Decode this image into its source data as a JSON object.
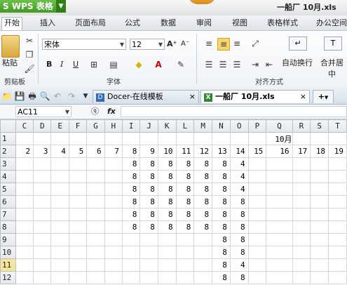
{
  "app": {
    "badge": "WPS 表格",
    "badge_prefix": "S",
    "doc_title": "一船厂 10月.xls"
  },
  "tabs": [
    "开始",
    "插入",
    "页面布局",
    "公式",
    "数据",
    "审阅",
    "视图",
    "表格样式",
    "办公空间"
  ],
  "ribbon": {
    "paste_label": "粘贴",
    "clipboard_label": "剪贴板",
    "font_name": "宋体",
    "font_size": "12",
    "bold": "B",
    "italic": "I",
    "underline": "U",
    "grow_font": "A⁺",
    "shrink_font": "A⁻",
    "font_group_label": "字体",
    "wrap_label": "自动换行",
    "merge_label": "合并居中",
    "align_group_label": "对齐方式"
  },
  "doc_tabs": [
    {
      "label": "Docer-在线模板",
      "closable": "×"
    },
    {
      "label": "一船厂 10月.xls",
      "closable": "×"
    }
  ],
  "add_tab": "+",
  "formula_bar": {
    "name_box": "AC11",
    "fx": "fx",
    "zoom": "ⓠ",
    "formula": ""
  },
  "sheet": {
    "columns": [
      "C",
      "D",
      "E",
      "F",
      "G",
      "H",
      "I",
      "J",
      "K",
      "L",
      "M",
      "N",
      "O",
      "P",
      "Q",
      "R",
      "S",
      "T"
    ],
    "rows": [
      {
        "num": "1",
        "cells": [
          "",
          "",
          "",
          "",
          "",
          "",
          "",
          "",
          "",
          "",
          "",
          "",
          "",
          "",
          "10月",
          "",
          "",
          ""
        ]
      },
      {
        "num": "2",
        "cells": [
          "2",
          "3",
          "4",
          "5",
          "6",
          "7",
          "8",
          "9",
          "10",
          "11",
          "12",
          "13",
          "14",
          "15",
          "16",
          "17",
          "18",
          "19"
        ]
      },
      {
        "num": "3",
        "cells": [
          "",
          "",
          "",
          "",
          "",
          "",
          "8",
          "8",
          "8",
          "8",
          "8",
          "8",
          "4",
          "",
          "",
          "",
          "",
          ""
        ]
      },
      {
        "num": "4",
        "cells": [
          "",
          "",
          "",
          "",
          "",
          "",
          "8",
          "8",
          "8",
          "8",
          "8",
          "8",
          "4",
          "",
          "",
          "",
          "",
          ""
        ]
      },
      {
        "num": "5",
        "cells": [
          "",
          "",
          "",
          "",
          "",
          "",
          "8",
          "8",
          "8",
          "8",
          "8",
          "8",
          "4",
          "",
          "",
          "",
          "",
          ""
        ]
      },
      {
        "num": "6",
        "cells": [
          "",
          "",
          "",
          "",
          "",
          "",
          "8",
          "8",
          "8",
          "8",
          "8",
          "8",
          "8",
          "",
          "",
          "",
          "",
          ""
        ]
      },
      {
        "num": "7",
        "cells": [
          "",
          "",
          "",
          "",
          "",
          "",
          "8",
          "8",
          "8",
          "8",
          "8",
          "8",
          "8",
          "",
          "",
          "",
          "",
          ""
        ]
      },
      {
        "num": "8",
        "cells": [
          "",
          "",
          "",
          "",
          "",
          "",
          "8",
          "8",
          "8",
          "8",
          "8",
          "8",
          "8",
          "",
          "",
          "",
          "",
          ""
        ]
      },
      {
        "num": "9",
        "cells": [
          "",
          "",
          "",
          "",
          "",
          "",
          "",
          "",
          "",
          "",
          "",
          "8",
          "8",
          "",
          "",
          "",
          "",
          ""
        ]
      },
      {
        "num": "10",
        "cells": [
          "",
          "",
          "",
          "",
          "",
          "",
          "",
          "",
          "",
          "",
          "",
          "8",
          "8",
          "",
          "",
          "",
          "",
          ""
        ]
      },
      {
        "num": "11",
        "cells": [
          "",
          "",
          "",
          "",
          "",
          "",
          "",
          "",
          "",
          "",
          "",
          "8",
          "4",
          "",
          "",
          "",
          "",
          ""
        ],
        "selected": true
      },
      {
        "num": "12",
        "cells": [
          "",
          "",
          "",
          "",
          "",
          "",
          "",
          "",
          "",
          "",
          "",
          "8",
          "8",
          "",
          "",
          "",
          "",
          ""
        ]
      }
    ]
  }
}
